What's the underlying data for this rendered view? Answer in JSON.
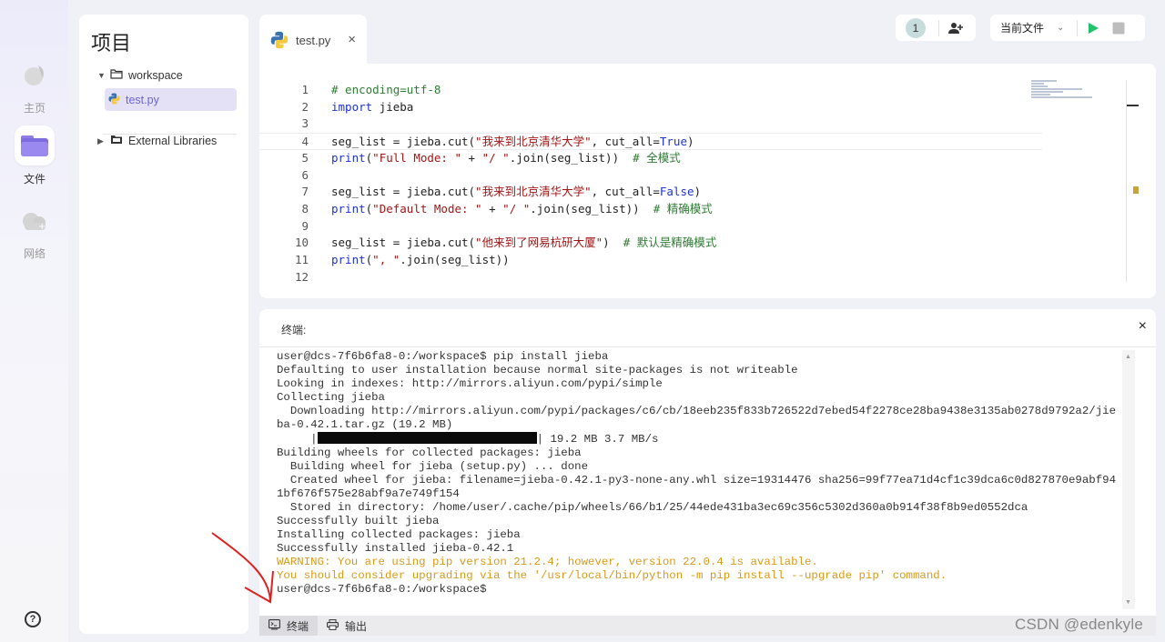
{
  "nav": {
    "items": [
      {
        "label": "主页",
        "icon": "home-icon"
      },
      {
        "label": "文件",
        "icon": "folder-icon"
      },
      {
        "label": "网络",
        "icon": "cloud-icon"
      }
    ],
    "help_icon": "help-icon"
  },
  "project": {
    "title": "项目",
    "tree": [
      {
        "label": "workspace",
        "expanded": true
      },
      {
        "label": "test.py",
        "selected": true
      },
      {
        "label": "External Libraries",
        "expanded": false
      }
    ]
  },
  "tab": {
    "label": "test.py",
    "close": "×"
  },
  "controls": {
    "user_count": "1",
    "file_select": "当前文件",
    "run_color": "#20c26a",
    "stop_color": "#bdbdbd"
  },
  "editor": {
    "lines": [
      {
        "n": "1",
        "parts": [
          {
            "t": "# encoding=utf-8",
            "c": "cmt"
          }
        ]
      },
      {
        "n": "2",
        "parts": [
          {
            "t": "import",
            "c": "kw"
          },
          {
            "t": " jieba",
            "c": ""
          }
        ]
      },
      {
        "n": "3",
        "parts": []
      },
      {
        "n": "4",
        "parts": [
          {
            "t": "seg_list = jieba.cut(",
            "c": ""
          },
          {
            "t": "\"我来到北京清华大学\"",
            "c": "str"
          },
          {
            "t": ", cut_all=",
            "c": ""
          },
          {
            "t": "True",
            "c": "kw"
          },
          {
            "t": ")",
            "c": ""
          }
        ]
      },
      {
        "n": "5",
        "parts": [
          {
            "t": "print",
            "c": "fn"
          },
          {
            "t": "(",
            "c": ""
          },
          {
            "t": "\"Full Mode: \"",
            "c": "str"
          },
          {
            "t": " + ",
            "c": ""
          },
          {
            "t": "\"/ \"",
            "c": "str"
          },
          {
            "t": ".join(seg_list))  ",
            "c": ""
          },
          {
            "t": "# 全模式",
            "c": "cmt"
          }
        ]
      },
      {
        "n": "6",
        "parts": []
      },
      {
        "n": "7",
        "parts": [
          {
            "t": "seg_list = jieba.cut(",
            "c": ""
          },
          {
            "t": "\"我来到北京清华大学\"",
            "c": "str"
          },
          {
            "t": ", cut_all=",
            "c": ""
          },
          {
            "t": "False",
            "c": "kw"
          },
          {
            "t": ")",
            "c": ""
          }
        ]
      },
      {
        "n": "8",
        "parts": [
          {
            "t": "print",
            "c": "fn"
          },
          {
            "t": "(",
            "c": ""
          },
          {
            "t": "\"Default Mode: \"",
            "c": "str"
          },
          {
            "t": " + ",
            "c": ""
          },
          {
            "t": "\"/ \"",
            "c": "str"
          },
          {
            "t": ".join(seg_list))  ",
            "c": ""
          },
          {
            "t": "# 精确模式",
            "c": "cmt"
          }
        ]
      },
      {
        "n": "9",
        "parts": []
      },
      {
        "n": "10",
        "parts": [
          {
            "t": "seg_list = jieba.cut(",
            "c": ""
          },
          {
            "t": "\"他来到了网易杭研大厦\"",
            "c": "str"
          },
          {
            "t": ")  ",
            "c": ""
          },
          {
            "t": "# 默认是精确模式",
            "c": "cmt"
          }
        ]
      },
      {
        "n": "11",
        "parts": [
          {
            "t": "print",
            "c": "fn"
          },
          {
            "t": "(",
            "c": ""
          },
          {
            "t": "\", \"",
            "c": "str"
          },
          {
            "t": ".join(seg_list))",
            "c": ""
          }
        ]
      },
      {
        "n": "12",
        "parts": []
      }
    ],
    "current_line": "4"
  },
  "terminal": {
    "title": "终端:",
    "close": "×",
    "lines": [
      {
        "t": "user@dcs-7f6b6fa8-0:/workspace$ pip install jieba"
      },
      {
        "t": "Defaulting to user installation because normal site-packages is not writeable"
      },
      {
        "t": "Looking in indexes: http://mirrors.aliyun.com/pypi/simple"
      },
      {
        "t": "Collecting jieba"
      },
      {
        "t": "  Downloading http://mirrors.aliyun.com/pypi/packages/c6/cb/18eeb235f833b726522d7ebed54f2278ce28ba9438e3135ab0278d9792a2/jie"
      },
      {
        "t": "ba-0.42.1.tar.gz (19.2 MB)"
      },
      {
        "t": "     |",
        "bar": true,
        "after": "| 19.2 MB 3.7 MB/s"
      },
      {
        "t": "Building wheels for collected packages: jieba"
      },
      {
        "t": "  Building wheel for jieba (setup.py) ... done"
      },
      {
        "t": "  Created wheel for jieba: filename=jieba-0.42.1-py3-none-any.whl size=19314476 sha256=99f77ea71d4cf1c39dca6c0d827870e9abf94"
      },
      {
        "t": "1bf676f575e28abf9a7e749f154"
      },
      {
        "t": "  Stored in directory: /home/user/.cache/pip/wheels/66/b1/25/44ede431ba3ec69c356c5302d360a0b914f38f8b9ed0552dca"
      },
      {
        "t": "Successfully built jieba"
      },
      {
        "t": "Installing collected packages: jieba"
      },
      {
        "t": "Successfully installed jieba-0.42.1"
      },
      {
        "t": "WARNING: You are using pip version 21.2.4; however, version 22.0.4 is available.",
        "warn": true
      },
      {
        "t": "You should consider upgrading via the '/usr/local/bin/python -m pip install --upgrade pip' command.",
        "warn": true
      },
      {
        "t": "user@dcs-7f6b6fa8-0:/workspace$"
      }
    ]
  },
  "bottom_tabs": {
    "terminal": "终端",
    "output": "输出"
  },
  "watermark": "CSDN @edenkyle"
}
